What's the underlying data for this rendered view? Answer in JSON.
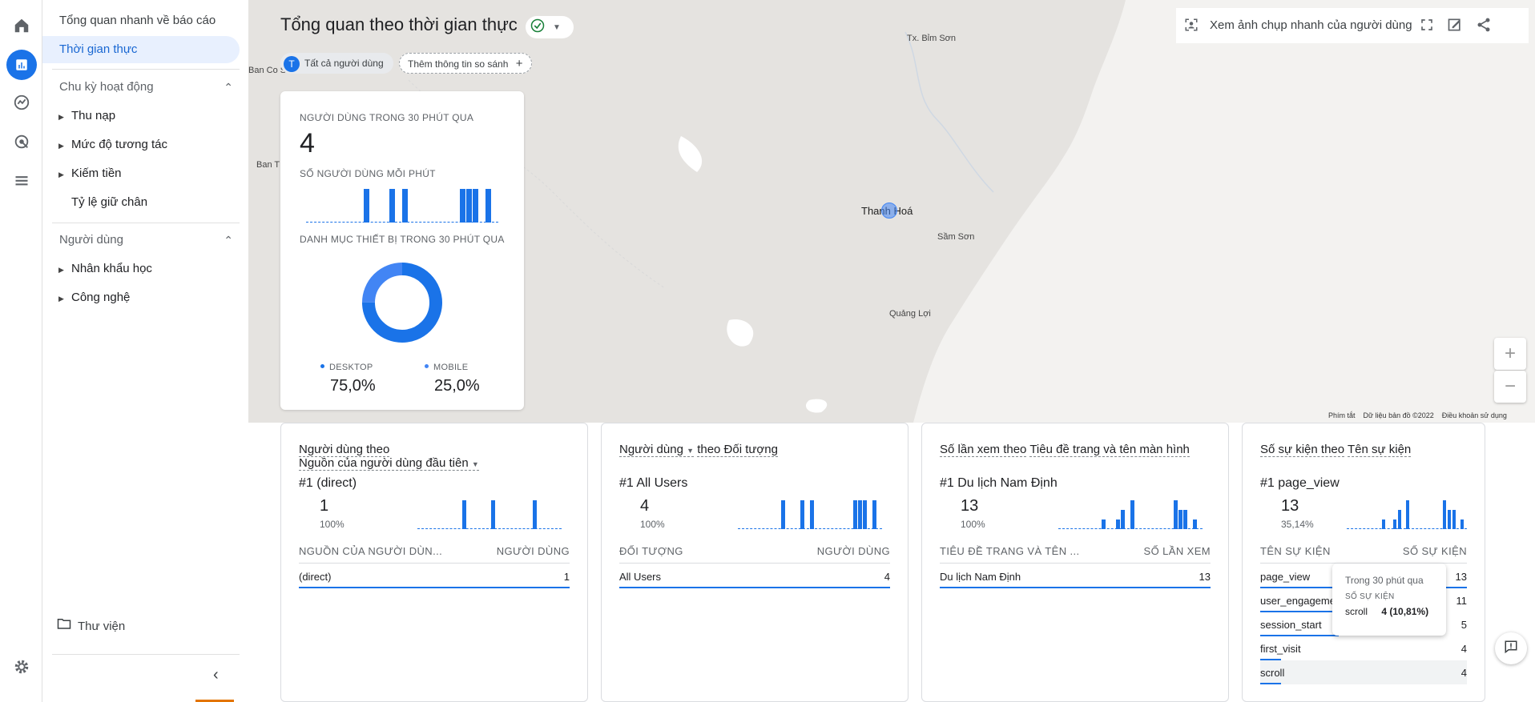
{
  "nav": {
    "item_overview": "Tổng quan nhanh về báo cáo",
    "item_realtime": "Thời gian thực",
    "section_lifecycle": "Chu kỳ hoạt động",
    "lifecycle_items": [
      "Thu nạp",
      "Mức độ tương tác",
      "Kiếm tiền",
      "Tỷ lệ giữ chân"
    ],
    "section_users": "Người dùng",
    "user_items": [
      "Nhân khẩu học",
      "Công nghệ"
    ],
    "library": "Thư viện"
  },
  "header": {
    "title": "Tổng quan theo thời gian thực",
    "snapshot": "Xem ảnh chụp nhanh của người dùng",
    "segment_chip_letter": "T",
    "segment_chip": "Tất cả người dùng",
    "compare_chip": "Thêm thông tin so sánh"
  },
  "map": {
    "places": [
      "Tx. Bỉm Sơn",
      "Thanh Hoá",
      "Sầm Sơn",
      "Quảng Lợi",
      "Ban Co Sam",
      "Ban T"
    ],
    "footer": [
      "Phím tắt",
      "Dữ liệu bản đồ ©2022",
      "Điều khoản sử dụng"
    ]
  },
  "realtime_card": {
    "users_label": "NGƯỜI DÙNG TRONG 30 PHÚT QUA",
    "users_value": "4",
    "per_minute_label": "SỐ NGƯỜI DÙNG MỖI PHÚT",
    "device_label": "DANH MỤC THIẾT BỊ TRONG 30 PHÚT QUA",
    "desktop_label": "DESKTOP",
    "desktop_value": "75,0%",
    "mobile_label": "MOBILE",
    "mobile_value": "25,0%"
  },
  "cards": [
    {
      "title_a": "Người dùng theo",
      "title_b": "Nguồn của người dùng đầu tiên",
      "rank": "#1  (direct)",
      "value": "1",
      "pct": "100%",
      "col1": "NGUỒN CỦA NGƯỜI DÙN...",
      "col2": "NGƯỜI DÙNG",
      "rows": [
        {
          "label": "(direct)",
          "value": "1"
        }
      ]
    },
    {
      "title_a": "Người dùng",
      "title_b": "theo Đối tượng",
      "rank": "#1  All Users",
      "value": "4",
      "pct": "100%",
      "col1": "ĐỐI TƯỢNG",
      "col2": "NGƯỜI DÙNG",
      "rows": [
        {
          "label": "All Users",
          "value": "4"
        }
      ]
    },
    {
      "title_a": "Số lần xem theo",
      "title_b": "Tiêu đề trang và tên màn hình",
      "rank": "#1  Du lịch Nam Định",
      "value": "13",
      "pct": "100%",
      "col1": "TIÊU ĐỀ TRANG VÀ TÊN ...",
      "col2": "SỐ LẦN XEM",
      "rows": [
        {
          "label": "Du lịch Nam Định",
          "value": "13"
        }
      ]
    },
    {
      "title_a": "Số sự kiện theo",
      "title_b": "Tên sự kiện",
      "rank": "#1  page_view",
      "value": "13",
      "pct": "35,14%",
      "col1": "TÊN SỰ KIỆN",
      "col2": "SỐ SỰ KIỆN",
      "rows": [
        {
          "label": "page_view",
          "value": "13"
        },
        {
          "label": "user_engageme",
          "value": "11"
        },
        {
          "label": "session_start",
          "value": "5"
        },
        {
          "label": "first_visit",
          "value": "4"
        },
        {
          "label": "scroll",
          "value": "4"
        }
      ]
    }
  ],
  "tooltip": {
    "title": "Trong 30 phút qua",
    "metric": "SỐ SỰ KIỆN",
    "name": "scroll",
    "value": "4 (10,81%)"
  },
  "colors": {
    "accent": "#1a73e8",
    "accent_light": "#4285f4",
    "ok_green": "#188038"
  }
}
